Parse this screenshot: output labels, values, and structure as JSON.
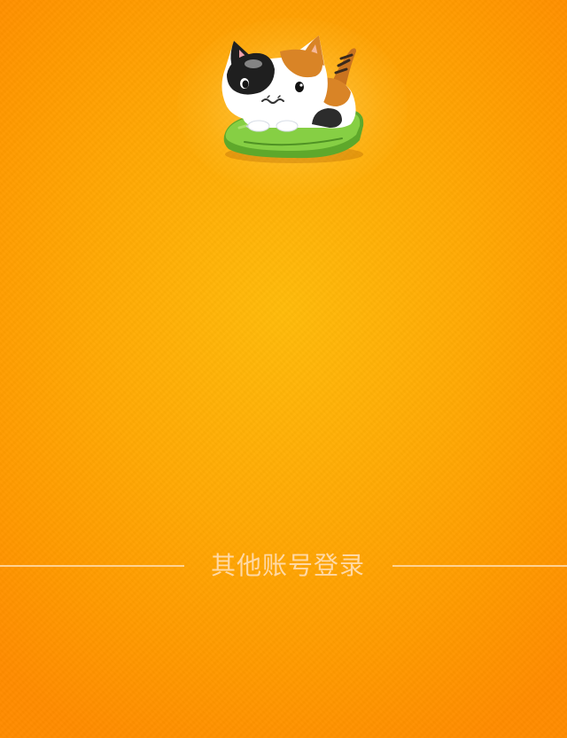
{
  "login": {
    "other_account_label": "其他账号登录"
  },
  "logo": {
    "icon": "calico-cat-on-green-cushion-icon"
  },
  "colors": {
    "background_center": "#ffbb0a",
    "background_edge": "#ff8c00",
    "divider_text": "#ffd9a6",
    "cushion": "#7cc63a"
  }
}
